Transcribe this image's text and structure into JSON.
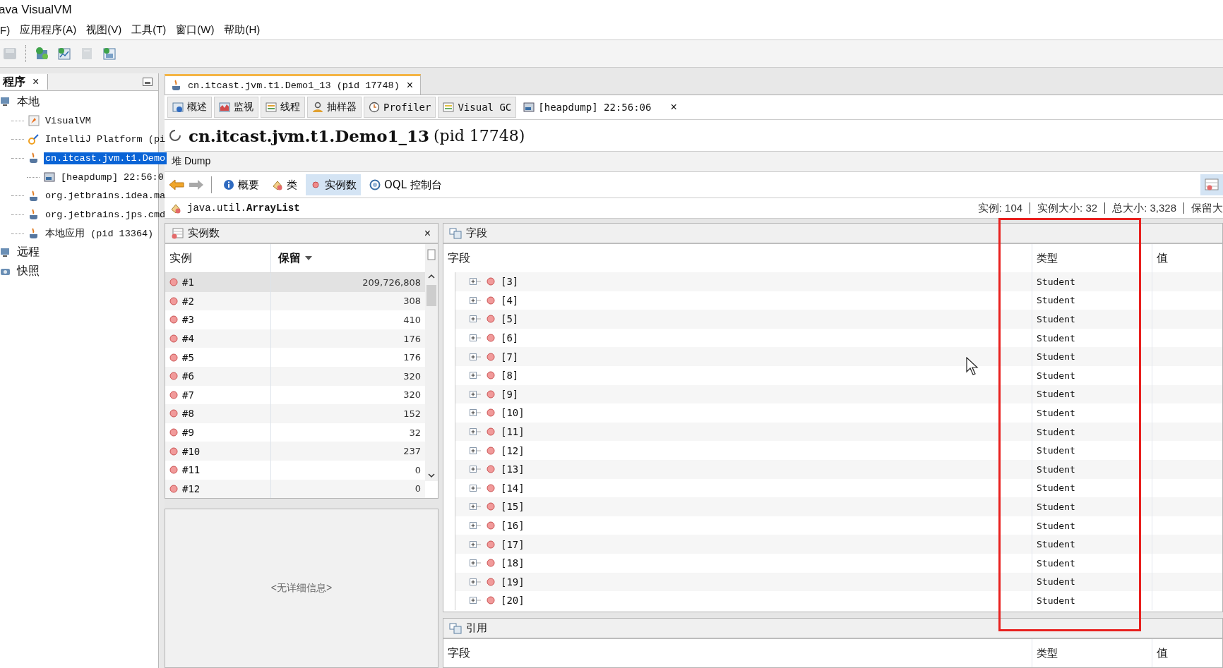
{
  "window": {
    "title": "ava VisualVM"
  },
  "menu": [
    {
      "label": "F)"
    },
    {
      "label": "应用程序(A)"
    },
    {
      "label": "视图(V)"
    },
    {
      "label": "工具(T)"
    },
    {
      "label": "窗口(W)"
    },
    {
      "label": "帮助(H)"
    }
  ],
  "toolbar": [
    {
      "kind": "save",
      "disabled": true
    },
    {
      "kind": "add-jmx",
      "disabled": false
    },
    {
      "kind": "heap",
      "disabled": false
    },
    {
      "kind": "snapshot",
      "disabled": true
    },
    {
      "kind": "core",
      "disabled": false
    }
  ],
  "sidebar": {
    "title": "程序",
    "close": "×",
    "items": [
      {
        "label": "本地",
        "kind": "host",
        "selected": false,
        "children": [
          {
            "label": "VisualVM",
            "kind": "visualvm",
            "selected": false
          },
          {
            "label": "IntelliJ Platform (pi",
            "kind": "intellij",
            "selected": false
          },
          {
            "label": "cn.itcast.jvm.t1.Demo",
            "kind": "java",
            "selected": true,
            "children": [
              {
                "label": "[heapdump] 22:56:0",
                "kind": "heapdump",
                "selected": false
              }
            ]
          },
          {
            "label": "org.jetbrains.idea.ma",
            "kind": "java",
            "selected": false
          },
          {
            "label": "org.jetbrains.jps.cmd",
            "kind": "java",
            "selected": false
          },
          {
            "label": "本地应用 (pid 13364)",
            "kind": "java",
            "selected": false
          }
        ]
      },
      {
        "label": "远程",
        "kind": "remote",
        "selected": false
      },
      {
        "label": "快照",
        "kind": "snapshots",
        "selected": false
      }
    ]
  },
  "document_tab": {
    "title": "cn.itcast.jvm.t1.Demo1_13 (pid 17748)",
    "close": "×"
  },
  "subtabs": [
    {
      "label": "概述",
      "kind": "overview",
      "selected": false
    },
    {
      "label": "监视",
      "kind": "monitor",
      "selected": false
    },
    {
      "label": "线程",
      "kind": "threads",
      "selected": false
    },
    {
      "label": "抽样器",
      "kind": "sampler",
      "selected": false
    },
    {
      "label": "Profiler",
      "kind": "profiler",
      "selected": false
    },
    {
      "label": "Visual GC",
      "kind": "gc",
      "selected": false
    },
    {
      "label": "[heapdump] 22:56:06",
      "kind": "heapdump",
      "selected": true,
      "close": "×"
    }
  ],
  "heading": {
    "name": "cn.itcast.jvm.t1.Demo1_13",
    "pid": "(pid 17748)"
  },
  "dump_bar": {
    "title": "堆 Dump"
  },
  "views": [
    {
      "label": "概要",
      "kind": "info",
      "selected": false
    },
    {
      "label": "类",
      "kind": "classes",
      "selected": false
    },
    {
      "label": "实例数",
      "kind": "instances",
      "selected": true
    },
    {
      "label": "OQL 控制台",
      "kind": "oql",
      "selected": false
    }
  ],
  "class_bar": {
    "name": "java.util.ArrayList",
    "stats": [
      "实例: 104",
      "实例大小: 32",
      "总大小: 3,328",
      "保留大"
    ]
  },
  "instances_panel": {
    "title": "实例数",
    "close": "×",
    "columns": [
      {
        "label": "实例",
        "sorted": false
      },
      {
        "label": "保留",
        "sorted": true
      }
    ],
    "rows": [
      {
        "name": "#1",
        "retained": "209,726,808",
        "selected": true
      },
      {
        "name": "#2",
        "retained": "308",
        "selected": false
      },
      {
        "name": "#3",
        "retained": "410",
        "selected": false
      },
      {
        "name": "#4",
        "retained": "176",
        "selected": false
      },
      {
        "name": "#5",
        "retained": "176",
        "selected": false
      },
      {
        "name": "#6",
        "retained": "320",
        "selected": false
      },
      {
        "name": "#7",
        "retained": "320",
        "selected": false
      },
      {
        "name": "#8",
        "retained": "152",
        "selected": false
      },
      {
        "name": "#9",
        "retained": "32",
        "selected": false
      },
      {
        "name": "#10",
        "retained": "237",
        "selected": false
      },
      {
        "name": "#11",
        "retained": "0",
        "selected": false
      },
      {
        "name": "#12",
        "retained": "0",
        "selected": false
      }
    ],
    "detail": "<无详细信息>"
  },
  "fields_panel": {
    "title": "字段",
    "columns": [
      "字段",
      "类型",
      "值"
    ],
    "rows": [
      {
        "name": "[3]",
        "type": "Student"
      },
      {
        "name": "[4]",
        "type": "Student"
      },
      {
        "name": "[5]",
        "type": "Student"
      },
      {
        "name": "[6]",
        "type": "Student"
      },
      {
        "name": "[7]",
        "type": "Student"
      },
      {
        "name": "[8]",
        "type": "Student"
      },
      {
        "name": "[9]",
        "type": "Student"
      },
      {
        "name": "[10]",
        "type": "Student"
      },
      {
        "name": "[11]",
        "type": "Student"
      },
      {
        "name": "[12]",
        "type": "Student"
      },
      {
        "name": "[13]",
        "type": "Student"
      },
      {
        "name": "[14]",
        "type": "Student"
      },
      {
        "name": "[15]",
        "type": "Student"
      },
      {
        "name": "[16]",
        "type": "Student"
      },
      {
        "name": "[17]",
        "type": "Student"
      },
      {
        "name": "[18]",
        "type": "Student"
      },
      {
        "name": "[19]",
        "type": "Student"
      },
      {
        "name": "[20]",
        "type": "Student"
      }
    ]
  },
  "references_panel": {
    "title": "引用",
    "columns": [
      "字段",
      "类型",
      "值"
    ]
  },
  "highlight": {
    "kind": "rectangle"
  }
}
